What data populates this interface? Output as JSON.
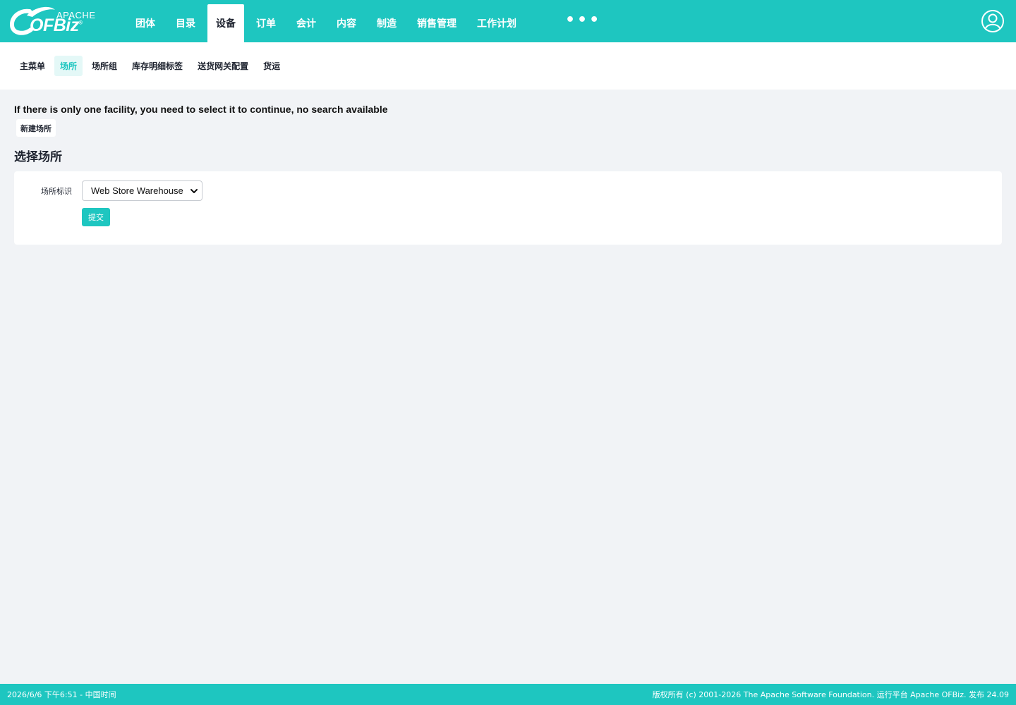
{
  "header": {
    "logo": {
      "top_text": "APACHE",
      "main_text": "OFBiz",
      "mark": "®"
    },
    "nav": [
      {
        "label": "团体"
      },
      {
        "label": "目录"
      },
      {
        "label": "设备",
        "active": true
      },
      {
        "label": "订单"
      },
      {
        "label": "会计"
      },
      {
        "label": "内容"
      },
      {
        "label": "制造"
      },
      {
        "label": "销售管理"
      },
      {
        "label": "工作计划"
      }
    ],
    "more_label": "•••",
    "user_icon": "user-circle-icon"
  },
  "subnav": [
    {
      "label": "主菜单"
    },
    {
      "label": "场所",
      "active": true
    },
    {
      "label": "场所组"
    },
    {
      "label": "库存明细标签"
    },
    {
      "label": "送货网关配置"
    },
    {
      "label": "货运"
    }
  ],
  "main": {
    "notice": "If there is only one facility, you need to select it to continue, no search available",
    "new_button": "新建场所",
    "section_title": "选择场所",
    "form": {
      "field_label": "场所标识",
      "selected_value": "Web Store Warehouse",
      "submit_label": "提交"
    }
  },
  "footer": {
    "left": "2026/6/6 下午6:51 - 中国时间",
    "right": "版权所有 (c) 2001-2026 The Apache Software Foundation. 运行平台 Apache OFBiz. 发布 24.09"
  },
  "colors": {
    "brand": "#1ec6c0",
    "background": "#f1f3f6",
    "active_tab_bg": "#e4f8f7"
  }
}
